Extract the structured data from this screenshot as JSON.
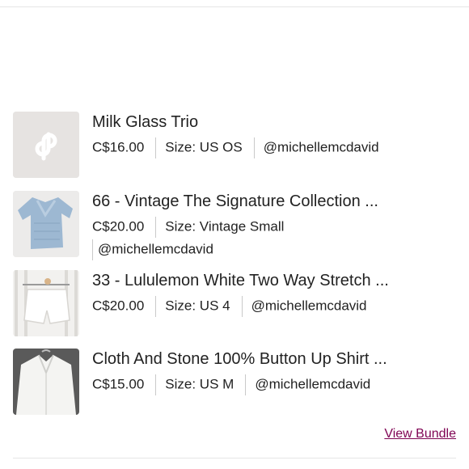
{
  "bundle": {
    "items": [
      {
        "title": "Milk Glass Trio",
        "price": "C$16.00",
        "size": "Size: US OS",
        "seller": "@michellemcdavid",
        "thumb_icon": "poshmark-logo-icon"
      },
      {
        "title": "66 - Vintage The Signature Collection ...",
        "price": "C$20.00",
        "size": "Size: Vintage Small",
        "seller": "@michellemcdavid",
        "thumb_icon": "sweater-photo"
      },
      {
        "title": "33 - Lululemon White Two Way Stretch ...",
        "price": "C$20.00",
        "size": "Size: US 4",
        "seller": "@michellemcdavid",
        "thumb_icon": "shorts-photo"
      },
      {
        "title": "Cloth And Stone 100% Button Up Shirt ...",
        "price": "C$15.00",
        "size": "Size: US M",
        "seller": "@michellemcdavid",
        "thumb_icon": "shirt-photo"
      }
    ],
    "view_bundle_label": "View Bundle",
    "link_color": "#7f0353"
  }
}
